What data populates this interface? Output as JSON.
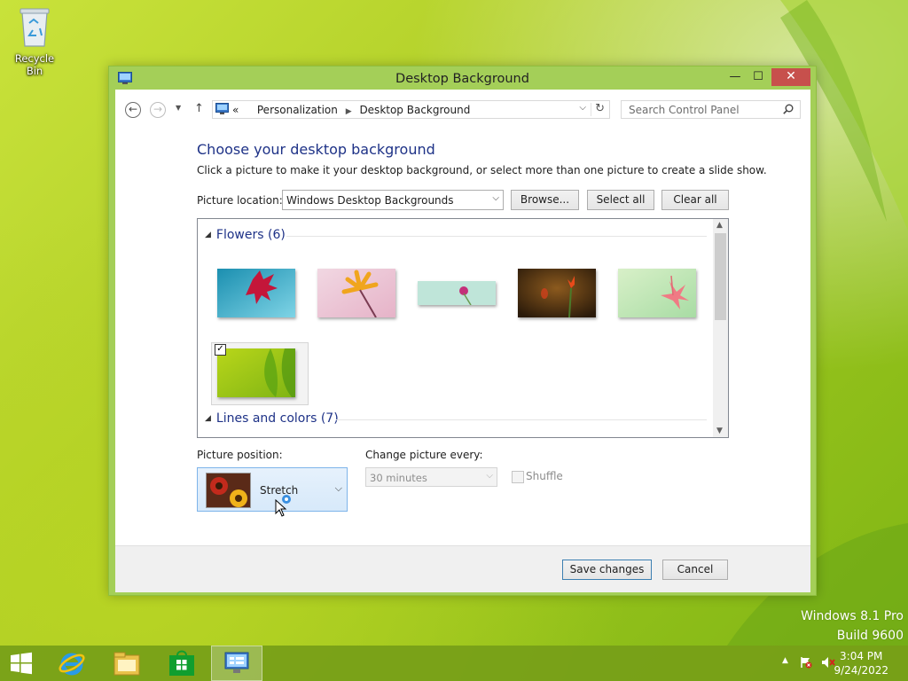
{
  "desktop": {
    "recycle_bin_label": "Recycle Bin",
    "watermark_line1": "Windows 8.1 Pro",
    "watermark_line2": "Build 9600"
  },
  "window": {
    "title": "Desktop Background",
    "controls": {
      "minimize": "—",
      "maximize": "☐",
      "close": "✕"
    }
  },
  "address_bar": {
    "back": "←",
    "forward": "→",
    "up": "↑",
    "prefix": "«",
    "crumbs": [
      "Personalization",
      "Desktop Background"
    ],
    "search_placeholder": "Search Control Panel"
  },
  "content": {
    "heading": "Choose your desktop background",
    "subtitle": "Click a picture to make it your desktop background, or select more than one picture to create a slide show.",
    "picture_location_label": "Picture location:",
    "picture_location_value": "Windows Desktop Backgrounds",
    "browse_label": "Browse...",
    "select_all_label": "Select all",
    "clear_all_label": "Clear all"
  },
  "gallery": {
    "groups": [
      {
        "title": "Flowers (6)",
        "selected_index": 5
      },
      {
        "title": "Lines and colors (7)"
      }
    ],
    "checkmark": "✓"
  },
  "options": {
    "picture_position_label": "Picture position:",
    "picture_position_value": "Stretch",
    "change_every_label": "Change picture every:",
    "change_every_value": "30 minutes",
    "shuffle_label": "Shuffle"
  },
  "footer": {
    "save_label": "Save changes",
    "cancel_label": "Cancel"
  },
  "taskbar": {
    "time": "3:04 PM",
    "date": "9/24/2022",
    "tray_arrow": "▲"
  },
  "colors": {
    "window_frame": "#a4cf58",
    "close_button": "#c7504c",
    "heading": "#1e3287",
    "taskbar": "#769e18"
  }
}
